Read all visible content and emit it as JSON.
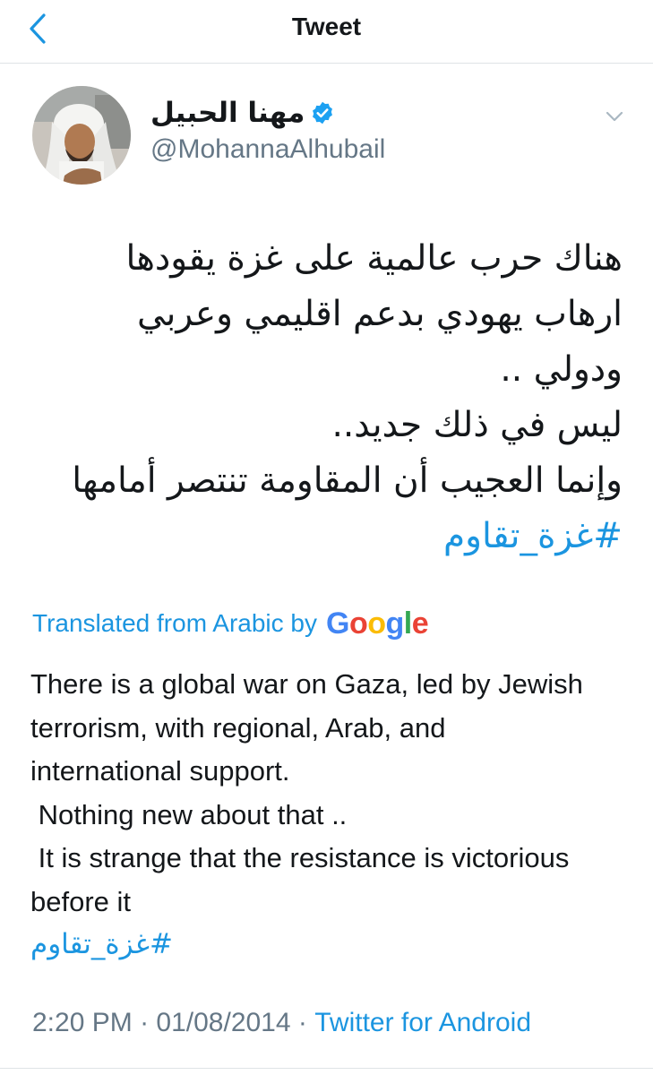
{
  "header": {
    "back_icon": "chevron-left-icon",
    "title": "Tweet"
  },
  "author": {
    "display_name": "مهنا الحبيل",
    "verified_icon": "verified-badge-icon",
    "handle": "@MohannaAlhubail",
    "menu_icon": "chevron-down-icon"
  },
  "tweet": {
    "arabic_lines": [
      "هناك حرب عالمية على غزة يقودها",
      "ارهاب يهودي بدعم اقليمي وعربي",
      "ودولي ..",
      "ليس في ذلك جديد..",
      "وإنما العجيب أن المقاومة تنتصر أمامها"
    ],
    "hashtag": "#غزة_تقاوم",
    "translation_label": "Translated from Arabic by",
    "translation_provider": "Google",
    "english_lines": [
      "There is a global war on Gaza, led by Jewish",
      "terrorism, with regional, Arab, and",
      "international support.",
      " Nothing new about that ..",
      " It is strange that the resistance is victorious",
      "before it"
    ],
    "english_hashtag": "#غزة_تقاوم"
  },
  "meta": {
    "time": "2:20 PM",
    "separator": " · ",
    "date": "01/08/2014",
    "source": "Twitter for Android"
  },
  "colors": {
    "accent": "#1b95e0",
    "text": "#14171a",
    "secondary": "#657786",
    "divider": "#dfe3e6"
  }
}
